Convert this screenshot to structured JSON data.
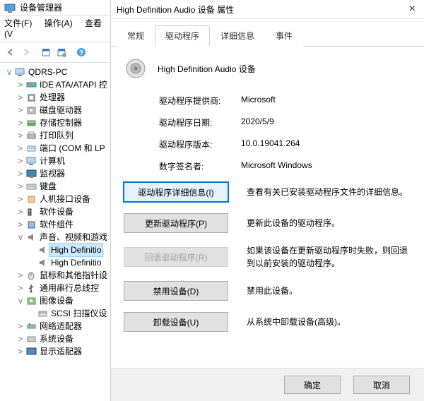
{
  "devmgr": {
    "title": "设备管理器",
    "menu": {
      "file": "文件(F)",
      "action": "操作(A)",
      "view": "查看(V"
    },
    "root": "QDRS-PC",
    "cats": [
      {
        "exp": ">",
        "label": "IDE ATA/ATAPI 控",
        "icon": "ide"
      },
      {
        "exp": ">",
        "label": "处理器",
        "icon": "cpu"
      },
      {
        "exp": ">",
        "label": "磁盘驱动器",
        "icon": "disk"
      },
      {
        "exp": ">",
        "label": "存储控制器",
        "icon": "storage"
      },
      {
        "exp": ">",
        "label": "打印队列",
        "icon": "printer"
      },
      {
        "exp": ">",
        "label": "端口 (COM 和 LP",
        "icon": "port"
      },
      {
        "exp": ">",
        "label": "计算机",
        "icon": "computer"
      },
      {
        "exp": ">",
        "label": "监视器",
        "icon": "monitor"
      },
      {
        "exp": ">",
        "label": "键盘",
        "icon": "keyboard"
      },
      {
        "exp": ">",
        "label": "人机接口设备",
        "icon": "hid"
      },
      {
        "exp": ">",
        "label": "软件设备",
        "icon": "swdev"
      },
      {
        "exp": ">",
        "label": "软件组件",
        "icon": "swcomp"
      },
      {
        "exp": "v",
        "label": "声音、视频和游戏",
        "icon": "audio"
      },
      {
        "exp": ">",
        "label": "鼠标和其他指针设",
        "icon": "mouse"
      },
      {
        "exp": ">",
        "label": "通用串行总线控",
        "icon": "usb"
      },
      {
        "exp": "v",
        "label": "图像设备",
        "icon": "image"
      },
      {
        "exp": ">",
        "label": "网络适配器",
        "icon": "network"
      },
      {
        "exp": ">",
        "label": "系统设备",
        "icon": "system"
      },
      {
        "exp": ">",
        "label": "显示适配器",
        "icon": "display"
      }
    ],
    "audio_children": [
      "High Definitio",
      "High Definitio"
    ],
    "image_children": [
      "SCSI 扫描仪设"
    ]
  },
  "dlg": {
    "title": "High Definition Audio 设备 属性",
    "tabs": [
      "常规",
      "驱动程序",
      "详细信息",
      "事件"
    ],
    "active_tab": 1,
    "device_name": "High Definition Audio 设备",
    "info": {
      "provider_k": "驱动程序提供商:",
      "provider_v": "Microsoft",
      "date_k": "驱动程序日期:",
      "date_v": "2020/5/9",
      "version_k": "驱动程序版本:",
      "version_v": "10.0.19041.264",
      "signer_k": "数字签名者:",
      "signer_v": "Microsoft Windows"
    },
    "actions": {
      "details": {
        "label": "驱动程序详细信息(I)",
        "desc": "查看有关已安装驱动程序文件的详细信息。"
      },
      "update": {
        "label": "更新驱动程序(P)",
        "desc": "更新此设备的驱动程序。"
      },
      "rollback": {
        "label": "回退驱动程序(R)",
        "desc": "如果该设备在更新驱动程序时失败，则回退到以前安装的驱动程序。"
      },
      "disable": {
        "label": "禁用设备(D)",
        "desc": "禁用此设备。"
      },
      "uninstall": {
        "label": "卸载设备(U)",
        "desc": "从系统中卸载设备(高级)。"
      }
    },
    "footer": {
      "ok": "确定",
      "cancel": "取消"
    }
  }
}
